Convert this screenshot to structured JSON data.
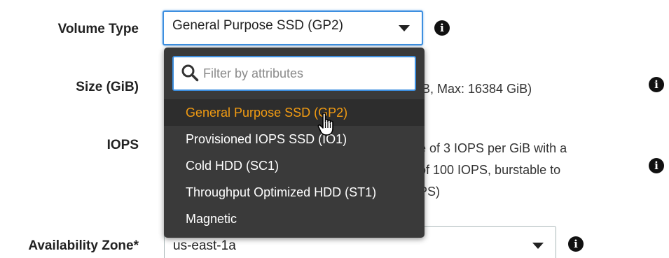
{
  "form": {
    "volume_type": {
      "label": "Volume Type",
      "selected_value": "General Purpose SSD (GP2)"
    },
    "size": {
      "label": "Size (GiB)",
      "helper_visible": "iB, Max: 16384 GiB)"
    },
    "iops": {
      "label": "IOPS",
      "helper_lines_visible": [
        "e of 3 IOPS per GiB with a",
        "of 100 IOPS, burstable to",
        "PS)"
      ]
    },
    "availability_zone": {
      "label": "Availability Zone*",
      "selected_value": "us-east-1a"
    }
  },
  "dropdown": {
    "filter_placeholder": "Filter by attributes",
    "options": [
      {
        "label": "General Purpose SSD (GP2)",
        "selected": true
      },
      {
        "label": "Provisioned IOPS SSD (IO1)",
        "selected": false
      },
      {
        "label": "Cold HDD (SC1)",
        "selected": false
      },
      {
        "label": "Throughput Optimized HDD (ST1)",
        "selected": false
      },
      {
        "label": "Magnetic",
        "selected": false
      }
    ]
  },
  "icons": {
    "info": "info-icon",
    "search": "search-icon",
    "caret": "chevron-down-icon",
    "pointer": "hand-pointer-icon",
    "info_glyph": "i"
  },
  "colors": {
    "selected_option": "#f39c12",
    "focus_border": "#3d8fe0",
    "dropdown_bg": "#3a3a3a"
  }
}
